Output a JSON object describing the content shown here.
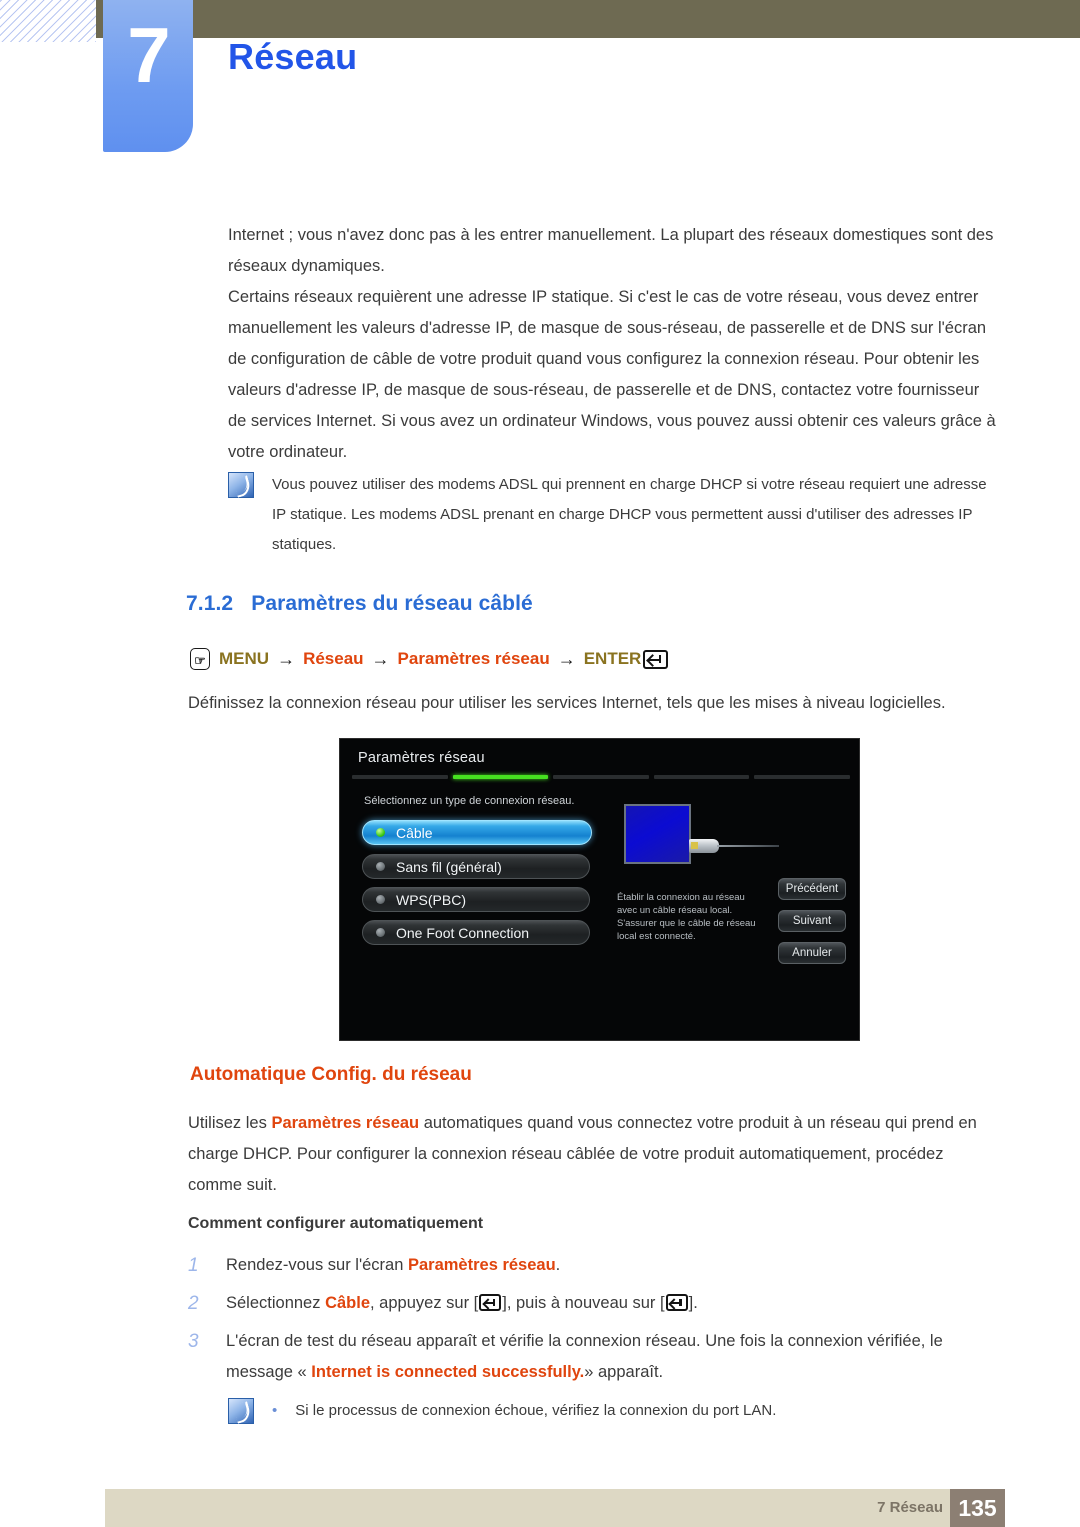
{
  "header": {
    "chapter_number": "7",
    "chapter_title": "Réseau"
  },
  "body": {
    "paragraph_1": "Internet ; vous n'avez donc pas à les entrer manuellement. La plupart des réseaux domestiques sont des réseaux dynamiques.",
    "paragraph_2": "Certains réseaux requièrent une adresse IP statique. Si c'est le cas de votre réseau, vous devez entrer manuellement les valeurs d'adresse IP, de masque de sous-réseau, de passerelle et de DNS sur l'écran de configuration de câble de votre produit quand vous configurez la connexion réseau. Pour obtenir les valeurs d'adresse IP, de masque de sous-réseau, de passerelle et de DNS, contactez votre fournisseur de services Internet. Si vous avez un ordinateur Windows, vous pouvez aussi obtenir ces valeurs grâce à votre ordinateur."
  },
  "note_top": {
    "icon": "note-pen-icon",
    "text": "Vous pouvez utiliser des modems ADSL qui prennent en charge DHCP si votre réseau requiert une adresse IP statique. Les modems ADSL prenant en charge DHCP vous permettent aussi d'utiliser des adresses IP statiques."
  },
  "section": {
    "number": "7.1.2",
    "title": "Paramètres du réseau câblé",
    "intro": "Définissez la connexion réseau pour utiliser les services Internet, tels que les mises à niveau logicielles."
  },
  "menu_path": {
    "press_icon": "hand-press-icon",
    "item_1": "MENU",
    "arrow": "→",
    "item_2": "Réseau",
    "item_3": "Paramètres réseau",
    "item_4": "ENTER",
    "enter_icon": "enter-key-icon",
    "color_olive": "#8a7320",
    "color_orange": "#e0450e"
  },
  "tv_screen": {
    "title": "Paramètres réseau",
    "tabs_total": 5,
    "tabs_active_index": 1,
    "subtitle": "Sélectionnez un type de connexion réseau.",
    "options": [
      {
        "label": "Câble",
        "selected": true
      },
      {
        "label": "Sans fil (général)",
        "selected": false
      },
      {
        "label": "WPS(PBC)",
        "selected": false
      },
      {
        "label": "One Foot Connection",
        "selected": false
      }
    ],
    "description": "Établir la connexion au réseau avec un câble réseau local. S'assurer que le câble de réseau local est connecté.",
    "illustration": "lan-port-cable-icon",
    "buttons": [
      "Précédent",
      "Suivant",
      "Annuler"
    ],
    "accent_green": "#46e020",
    "accent_blue": "#1481cf"
  },
  "auto_config": {
    "heading": "Automatique Config. du réseau",
    "paragraph_a": "Utilisez les ",
    "paragraph_b": "Paramètres réseau",
    "paragraph_c": " automatiques quand vous connectez votre produit à un réseau qui prend en charge DHCP. Pour configurer la connexion réseau câblée de votre produit automatiquement, procédez comme suit.",
    "howto_heading": "Comment configurer automatiquement",
    "steps": [
      {
        "num": "1",
        "pre": "Rendez-vous sur l'écran ",
        "highlight": "Paramètres réseau",
        "post": "."
      },
      {
        "num": "2",
        "pre": "Sélectionnez ",
        "highlight": "Câble",
        "mid": ", appuyez sur [",
        "mid2": "], puis à nouveau sur [",
        "post": "]."
      },
      {
        "num": "3",
        "pre": "L'écran de test du réseau apparaît et vérifie la connexion réseau. Une fois la connexion vérifiée, le message « ",
        "highlight": "Internet is connected successfully.",
        "post": "» apparaît."
      }
    ]
  },
  "note_bottom": {
    "icon": "note-pen-icon",
    "bullet": "•",
    "text": "Si le processus de connexion échoue, vérifiez la connexion du port LAN."
  },
  "footer": {
    "label": "7 Réseau",
    "page_number": "135"
  }
}
